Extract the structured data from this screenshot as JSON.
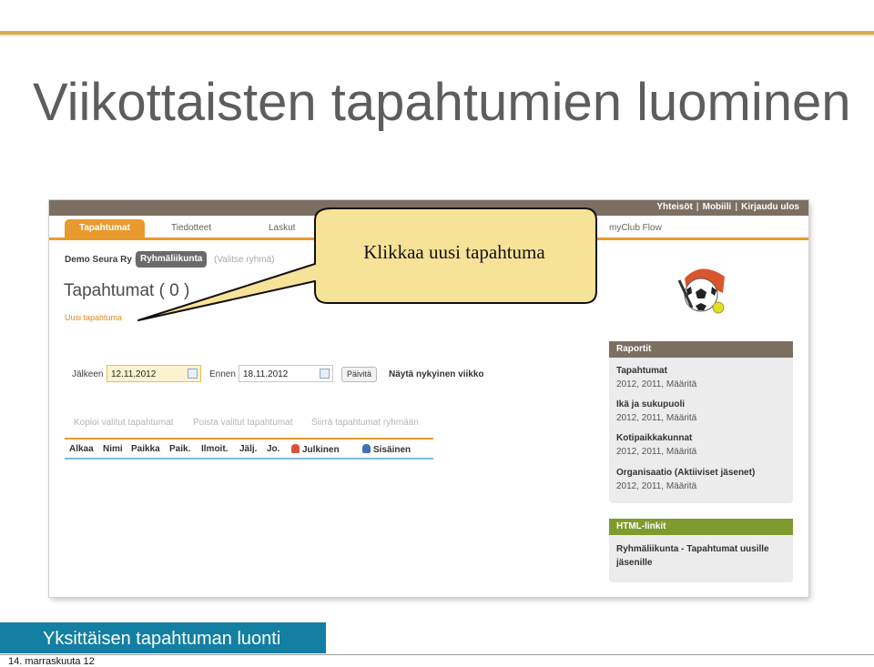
{
  "slide": {
    "title": "Viikottaisten tapahtumien luominen",
    "footer_title": "Yksittäisen tapahtuman luonti",
    "date": "14. marraskuuta 12",
    "accent_color": "#d9aa4a",
    "footer_color": "#127fa3"
  },
  "app": {
    "topnav": {
      "links": [
        "Yhteisöt",
        "Mobiili",
        "Kirjaudu ulos"
      ],
      "separator": "|"
    },
    "tabs": [
      "Tapahtumat",
      "Tiedotteet",
      "Laskut",
      "myClub Flow"
    ],
    "breadcrumb": {
      "club": "Demo Seura Ry »",
      "group_button": "Ryhmäliikunta",
      "group_select": "(Valitse ryhmä)"
    },
    "page_title": "Tapahtumat ( 0 )",
    "new_event_link": "Uusi tapahtuma",
    "filter": {
      "after_label": "Jälkeen",
      "after_value": "12.11.2012",
      "before_label": "Ennen",
      "before_value": "18.11.2012",
      "refresh_button": "Päivitä",
      "this_week_link": "Näytä nykyinen viikko"
    },
    "bulk_actions": [
      "Kopioi valitut tapahtumat",
      "Poista valitut tapahtumat",
      "Siirrä tapahtumat ryhmään"
    ],
    "columns": [
      "Alkaa",
      "Nimi",
      "Paikka",
      "Paik.",
      "Ilmoit.",
      "Jälj.",
      "Jo.",
      "Julkinen",
      "Sisäinen"
    ],
    "reports": {
      "header": "Raportit",
      "header_color": "#7c6f62",
      "items": [
        {
          "title": "Tapahtumat",
          "sub": "2012, 2011, Määritä"
        },
        {
          "title": "Ikä ja sukupuoli",
          "sub": "2012, 2011, Määritä"
        },
        {
          "title": "Kotipaikkakunnat",
          "sub": "2012, 2011, Määritä"
        },
        {
          "title": "Organisaatio (Aktiiviset jäsenet)",
          "sub": "2012, 2011, Määritä"
        }
      ]
    },
    "html_links": {
      "header": "HTML-linkit",
      "header_color": "#7e9c2e",
      "line1": "Ryhmäliikunta - Tapahtumat uusille",
      "line2": "jäsenille"
    }
  },
  "callout": {
    "text": "Klikkaa uusi tapahtuma"
  }
}
